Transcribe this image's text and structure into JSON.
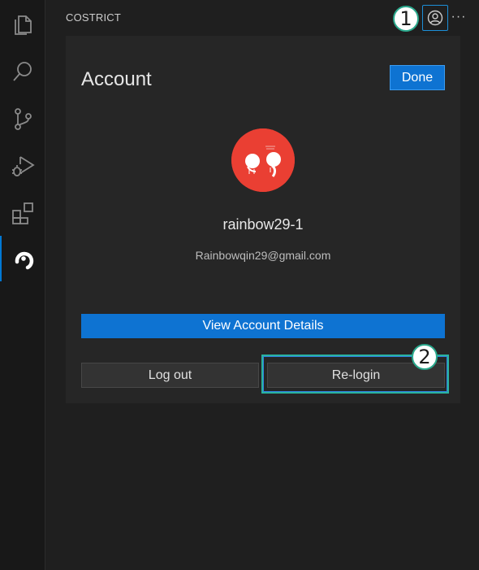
{
  "activity_bar": {
    "items": [
      {
        "name": "explorer-icon"
      },
      {
        "name": "search-icon"
      },
      {
        "name": "source-control-icon"
      },
      {
        "name": "run-debug-icon"
      },
      {
        "name": "extensions-icon"
      },
      {
        "name": "costrict-icon"
      }
    ]
  },
  "sidebar": {
    "title": "COSTRICT",
    "more_label": "···"
  },
  "annotations": {
    "first": "1",
    "second": "2"
  },
  "account_panel": {
    "title": "Account",
    "done_label": "Done",
    "username": "rainbow29-1",
    "email": "Rainbowqin29@gmail.com",
    "view_details_label": "View Account Details",
    "logout_label": "Log out",
    "relogin_label": "Re-login"
  },
  "colors": {
    "accent": "#0e73d2",
    "avatar_bg": "#ea3f33",
    "highlight": "#2ab3a0"
  }
}
